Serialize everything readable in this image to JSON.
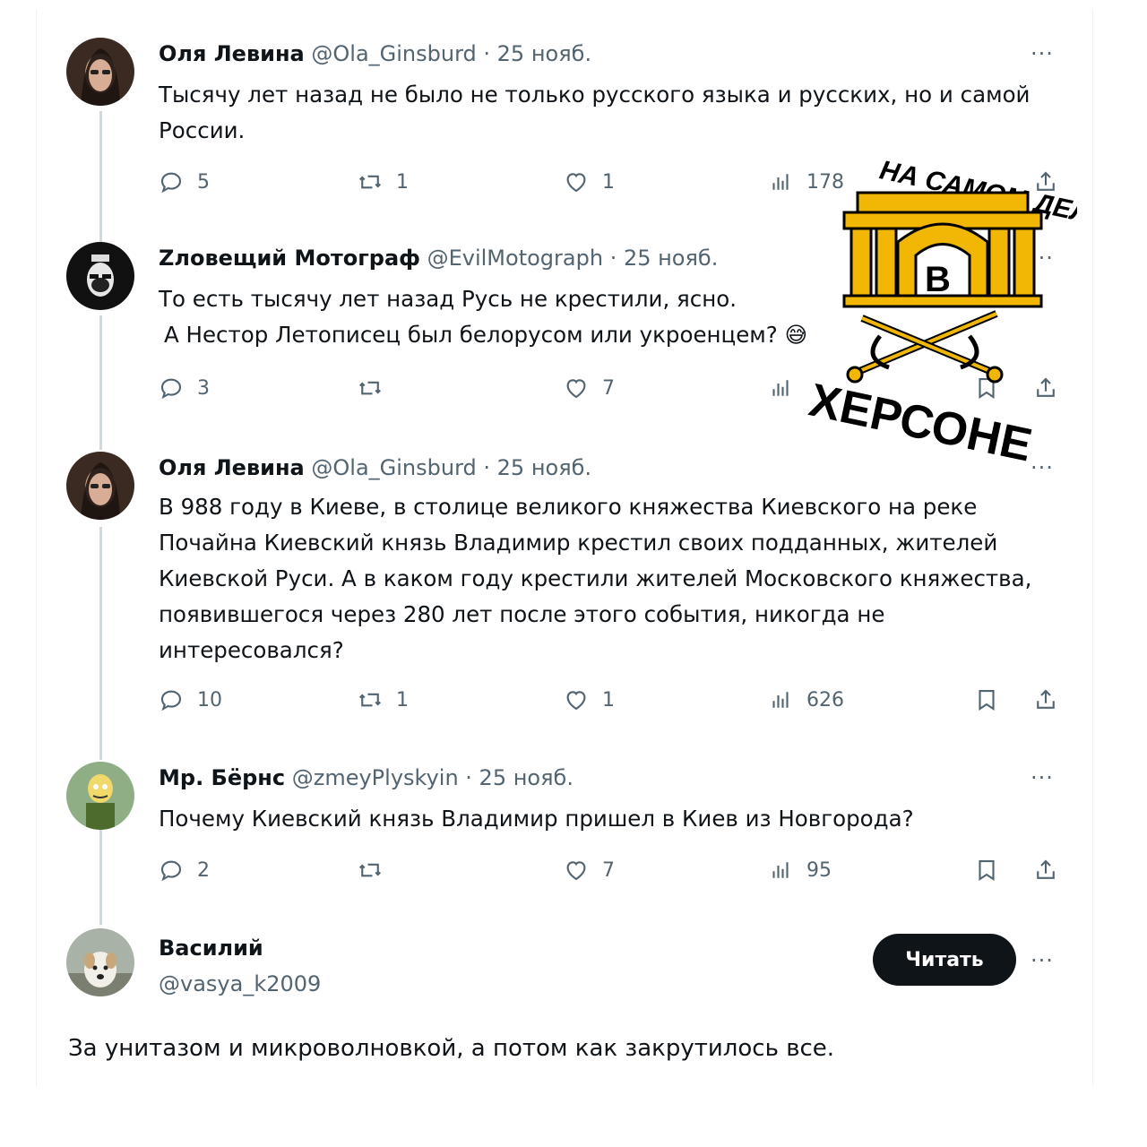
{
  "tweets": [
    {
      "name": "Оля Левина",
      "handle": "@Ola_Ginsburd",
      "date": "· 25 нояб.",
      "text": "Тысячу лет назад не было не только русского языка и русских, но и самой России.",
      "replies": "5",
      "reposts": "1",
      "likes": "1",
      "views": "178"
    },
    {
      "name": "Zловещий Мотограф",
      "handle": "@EvilMotograph",
      "date": "· 25 нояб.",
      "line1": "То есть тысячу лет назад Русь не крестили, ясно.",
      "line2": "А Нестор Летописец был белорусом или укроенцем? 😅",
      "replies": "3",
      "likes": "7"
    },
    {
      "name": "Оля Левина",
      "handle": "@Ola_Ginsburd",
      "date": "· 25 нояб.",
      "text": "В 988 году в Киеве, в столице великого княжества Киевского на реке Почайна Киевский князь Владимир крестил своих подданных, жителей Киевской Руси. А в каком году крестили жителей Московского княжества, появившегося через 280 лет после этого события, никогда не интересовался?",
      "replies": "10",
      "reposts": "1",
      "likes": "1",
      "views": "626"
    },
    {
      "name": "Мр. Бёрнс",
      "handle": "@zmeyPlyskyin",
      "date": "· 25 нояб.",
      "text": "Почему Киевский князь Владимир пришел в Киев из Новгорода?",
      "replies": "2",
      "likes": "7",
      "views": "95"
    }
  ],
  "main_tweet": {
    "name": "Василий",
    "handle": "@vasya_k2009",
    "follow_label": "Читать",
    "text": "За унитазом и микроволновкой, а потом как закрутилось все."
  },
  "logo": {
    "top_text": "НА САМОМ ДЕЛЕ",
    "letter": "В",
    "bottom_text": "ХЕРСОНЕ",
    "colors": {
      "gold": "#f2b705",
      "black": "#000000"
    }
  },
  "more_label": "···",
  "colors": {
    "text": "#0f1419",
    "secondary": "#536471",
    "thread_line": "#cfd9de",
    "button": "#0f1419"
  }
}
